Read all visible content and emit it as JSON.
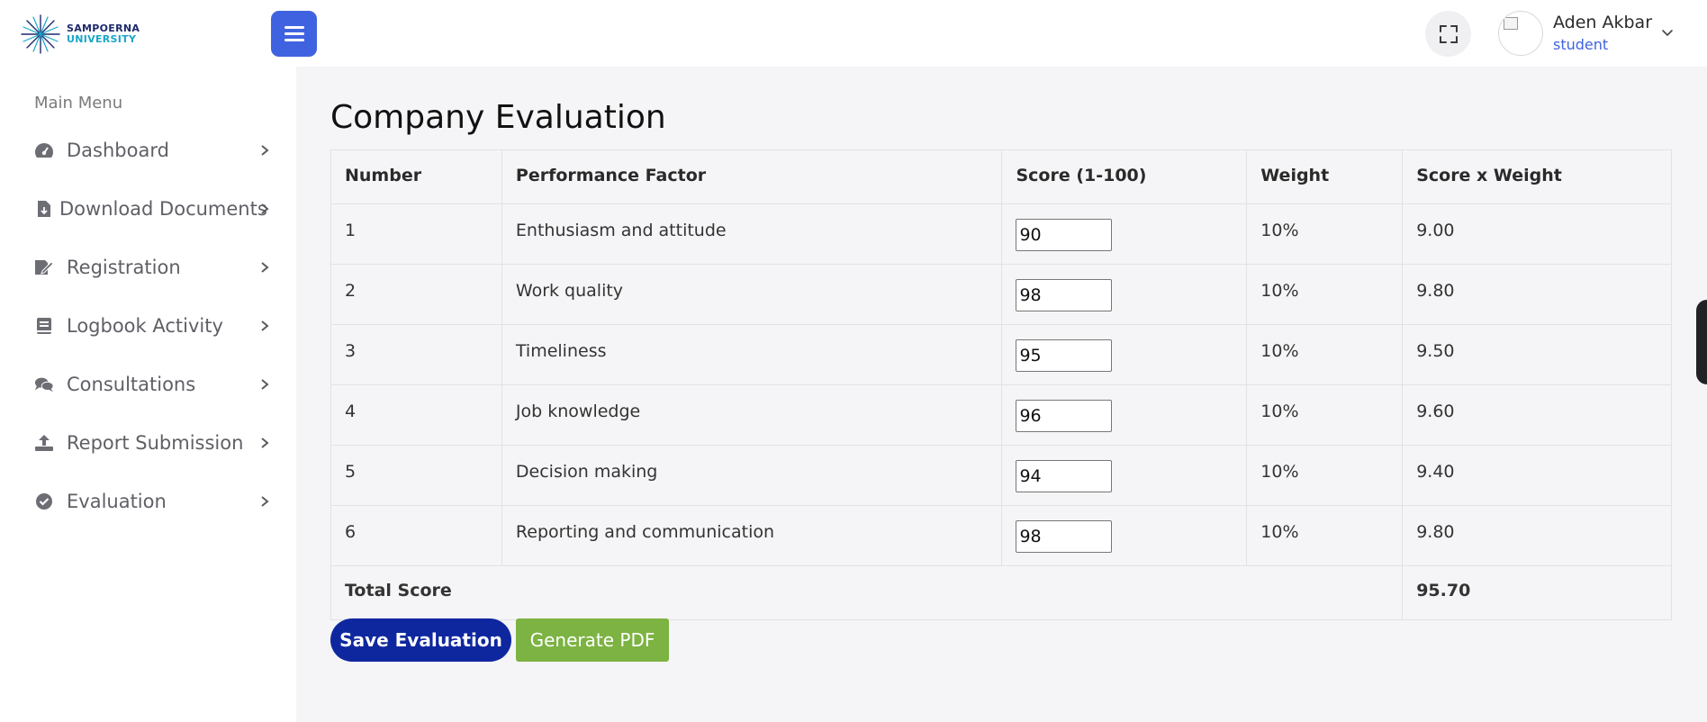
{
  "brand": {
    "line1": "SAMPOERNA",
    "line2": "UNIVERSITY",
    "primary_color": "#3f63e0",
    "dark_blue": "#0f279e",
    "green": "#7cb342"
  },
  "header": {
    "user_name": "Aden Akbar",
    "user_role": "student",
    "icons": [
      "menu-icon",
      "fullscreen-icon",
      "chevron-down-icon"
    ]
  },
  "sidebar": {
    "heading": "Main Menu",
    "items": [
      {
        "label": "Dashboard",
        "icon": "gauge-icon"
      },
      {
        "label": "Download Documents",
        "icon": "file-download-icon"
      },
      {
        "label": "Registration",
        "icon": "edit-signature-icon"
      },
      {
        "label": "Logbook Activity",
        "icon": "book-icon"
      },
      {
        "label": "Consultations",
        "icon": "comments-icon"
      },
      {
        "label": "Report Submission",
        "icon": "upload-icon"
      },
      {
        "label": "Evaluation",
        "icon": "check-circle-icon"
      }
    ]
  },
  "main": {
    "title": "Company Evaluation",
    "columns": [
      "Number",
      "Performance Factor",
      "Score (1-100)",
      "Weight",
      "Score x Weight"
    ],
    "rows": [
      {
        "number": "1",
        "factor": "Enthusiasm and attitude",
        "score": "90",
        "weight": "10%",
        "weighted": "9.00"
      },
      {
        "number": "2",
        "factor": "Work quality",
        "score": "98",
        "weight": "10%",
        "weighted": "9.80"
      },
      {
        "number": "3",
        "factor": "Timeliness",
        "score": "95",
        "weight": "10%",
        "weighted": "9.50"
      },
      {
        "number": "4",
        "factor": "Job knowledge",
        "score": "96",
        "weight": "10%",
        "weighted": "9.60"
      },
      {
        "number": "5",
        "factor": "Decision making",
        "score": "94",
        "weight": "10%",
        "weighted": "9.40"
      },
      {
        "number": "6",
        "factor": "Reporting and communication",
        "score": "98",
        "weight": "10%",
        "weighted": "9.80"
      }
    ],
    "total_label": "Total Score",
    "total_value": "95.70",
    "save_button": "Save Evaluation",
    "pdf_button": "Generate PDF"
  }
}
